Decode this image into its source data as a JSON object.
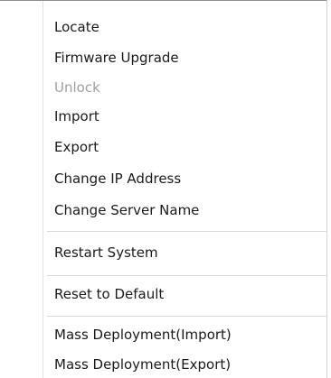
{
  "menu": {
    "items": [
      {
        "label": "Locate",
        "enabled": true
      },
      {
        "label": "Firmware Upgrade",
        "enabled": true
      },
      {
        "label": "Unlock",
        "enabled": false
      },
      {
        "label": "Import",
        "enabled": true
      },
      {
        "label": "Export",
        "enabled": true
      },
      {
        "label": "Change IP Address",
        "enabled": true
      },
      {
        "label": "Change Server Name",
        "enabled": true
      },
      {
        "label": "Restart System",
        "enabled": true
      },
      {
        "label": "Reset to Default",
        "enabled": true
      },
      {
        "label": "Mass Deployment(Import)",
        "enabled": true
      },
      {
        "label": "Mass Deployment(Export)",
        "enabled": true
      }
    ]
  },
  "colors": {
    "text": "#1a1a1a",
    "disabled_text": "#a0a0a0",
    "separator": "#d9d9d9",
    "background": "#ffffff"
  }
}
